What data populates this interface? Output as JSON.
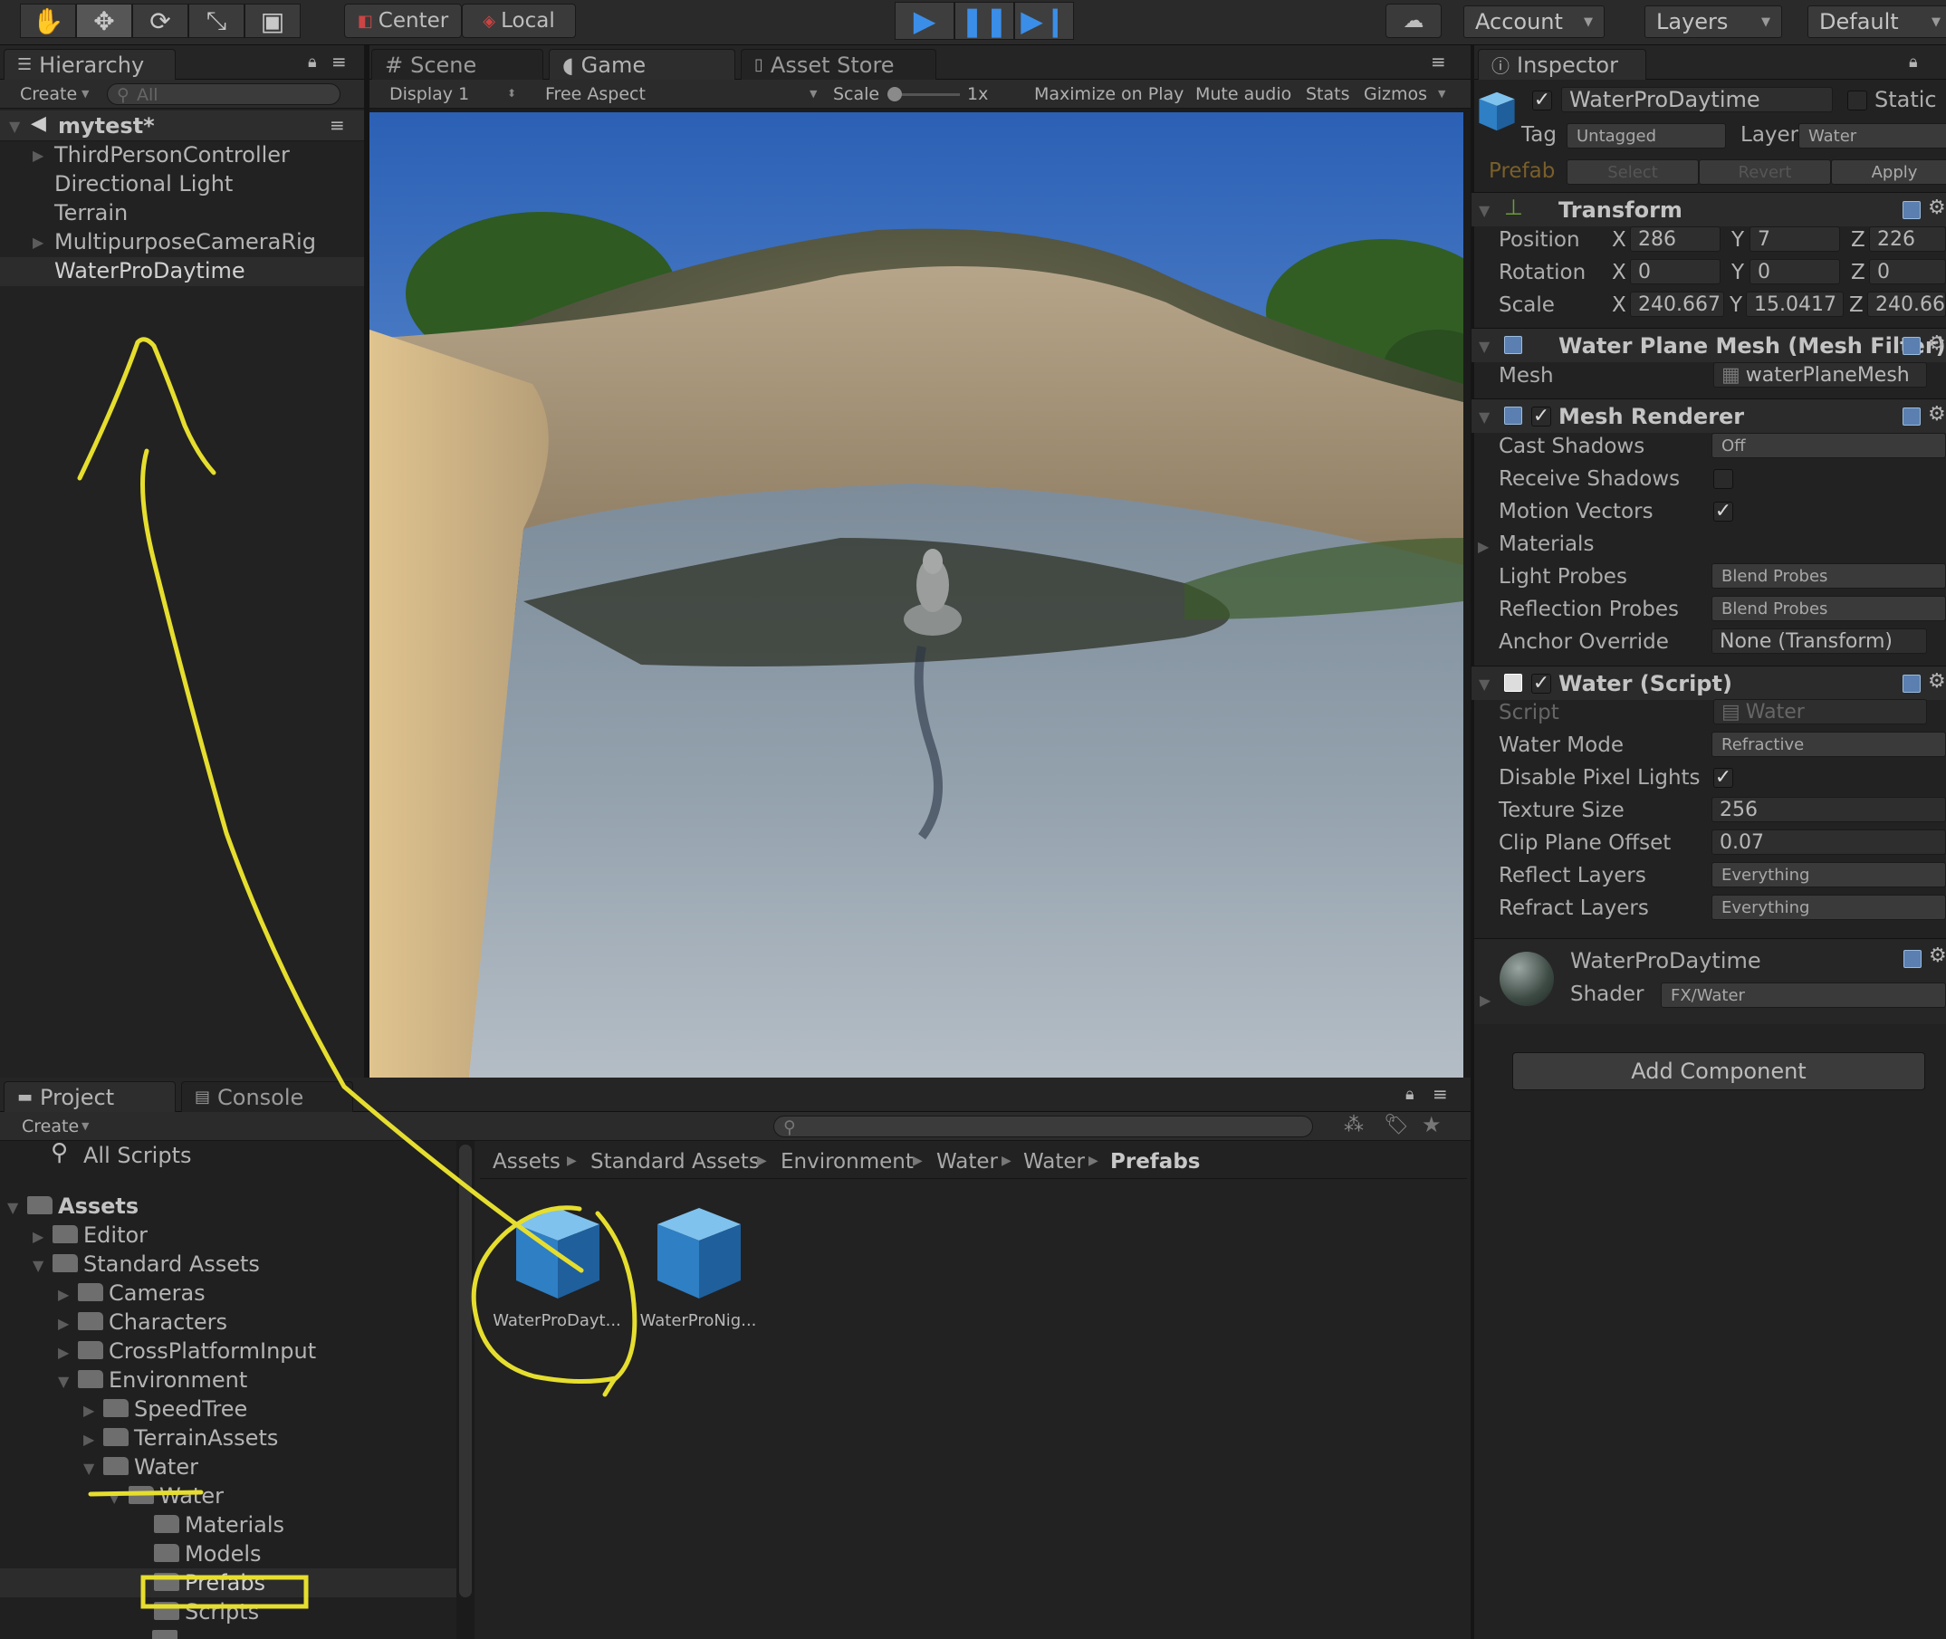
{
  "toolbar": {
    "pivot_center": "Center",
    "pivot_local": "Local",
    "account": "Account",
    "layers": "Layers",
    "layout": "Default"
  },
  "hierarchy": {
    "tab": "Hierarchy",
    "create": "Create",
    "search_placeholder": "All",
    "scene": "mytest*",
    "items": [
      "ThirdPersonController",
      "Directional Light",
      "Terrain",
      "MultipurposeCameraRig",
      "WaterProDaytime"
    ]
  },
  "view_tabs": {
    "scene": "Scene",
    "game": "Game",
    "asset_store": "Asset Store",
    "display": "Display 1",
    "aspect": "Free Aspect",
    "scale_label": "Scale",
    "scale_value": "1x",
    "maximize": "Maximize on Play",
    "mute": "Mute audio",
    "stats": "Stats",
    "gizmos": "Gizmos"
  },
  "project": {
    "tab": "Project",
    "console_tab": "Console",
    "create": "Create",
    "all_scripts": "All Scripts",
    "breadcrumb": [
      "Assets",
      "Standard Assets",
      "Environment",
      "Water",
      "Water",
      "Prefabs"
    ],
    "tree": {
      "assets": "Assets",
      "editor": "Editor",
      "standard_assets": "Standard Assets",
      "cameras": "Cameras",
      "characters": "Characters",
      "cross_platform": "CrossPlatformInput",
      "environment": "Environment",
      "speedtree": "SpeedTree",
      "terrain_assets": "TerrainAssets",
      "water": "Water",
      "water_inner": "Water",
      "materials": "Materials",
      "models": "Models",
      "prefabs": "Prefabs",
      "scripts": "Scripts"
    },
    "assets": [
      "WaterProDayt...",
      "WaterProNig..."
    ]
  },
  "inspector": {
    "tab": "Inspector",
    "object_name": "WaterProDaytime",
    "static": "Static",
    "tag_label": "Tag",
    "tag": "Untagged",
    "layer_label": "Layer",
    "layer": "Water",
    "prefab_label": "Prefab",
    "prefab_select": "Select",
    "prefab_revert": "Revert",
    "prefab_apply": "Apply",
    "transform": {
      "title": "Transform",
      "position_label": "Position",
      "rotation_label": "Rotation",
      "scale_label": "Scale",
      "x": "X",
      "y": "Y",
      "z": "Z",
      "position": [
        "286",
        "7",
        "226"
      ],
      "rotation": [
        "0",
        "0",
        "0"
      ],
      "scale": [
        "240.667",
        "15.0417",
        "240.66"
      ]
    },
    "mesh_filter": {
      "title": "Water Plane Mesh (Mesh Filter)",
      "mesh_label": "Mesh",
      "mesh": "waterPlaneMesh"
    },
    "mesh_renderer": {
      "title": "Mesh Renderer",
      "cast_shadows_label": "Cast Shadows",
      "cast_shadows": "Off",
      "receive_shadows_label": "Receive Shadows",
      "motion_vectors_label": "Motion Vectors",
      "materials_label": "Materials",
      "light_probes_label": "Light Probes",
      "light_probes": "Blend Probes",
      "reflection_probes_label": "Reflection Probes",
      "reflection_probes": "Blend Probes",
      "anchor_override_label": "Anchor Override",
      "anchor_override": "None (Transform)"
    },
    "water_script": {
      "title": "Water (Script)",
      "script_label": "Script",
      "script": "Water",
      "water_mode_label": "Water Mode",
      "water_mode": "Refractive",
      "disable_pixel_lights_label": "Disable Pixel Lights",
      "texture_size_label": "Texture Size",
      "texture_size": "256",
      "clip_plane_offset_label": "Clip Plane Offset",
      "clip_plane_offset": "0.07",
      "reflect_layers_label": "Reflect Layers",
      "reflect_layers": "Everything",
      "refract_layers_label": "Refract Layers",
      "refract_layers": "Everything"
    },
    "material": {
      "name": "WaterProDaytime",
      "shader_label": "Shader",
      "shader": "FX/Water"
    },
    "add_component": "Add Component"
  },
  "colors": {
    "annotation": "#e6de2e",
    "play_blue": "#3b8ee8",
    "selection": "#3e5f96"
  }
}
